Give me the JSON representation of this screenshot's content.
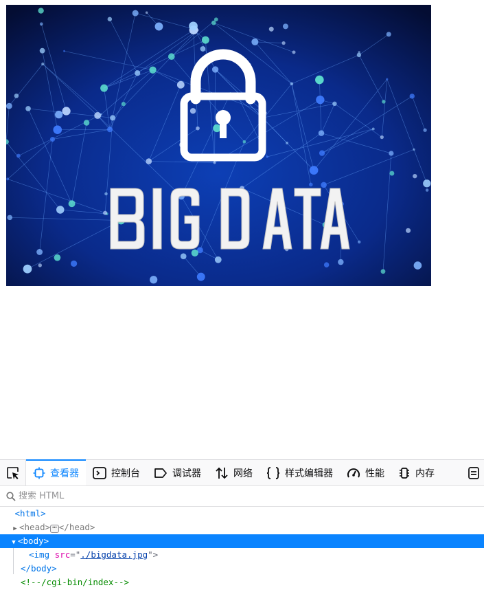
{
  "page": {
    "image": {
      "alt_text": "BIG DATA"
    }
  },
  "devtools": {
    "tabs": [
      {
        "label": "查看器",
        "icon": "inspector-icon",
        "selected": true
      },
      {
        "label": "控制台",
        "icon": "console-icon",
        "selected": false
      },
      {
        "label": "调试器",
        "icon": "debugger-icon",
        "selected": false
      },
      {
        "label": "网络",
        "icon": "network-icon",
        "selected": false
      },
      {
        "label": "样式编辑器",
        "icon": "style-editor-icon",
        "selected": false
      },
      {
        "label": "性能",
        "icon": "performance-icon",
        "selected": false
      },
      {
        "label": "内存",
        "icon": "memory-icon",
        "selected": false
      }
    ],
    "search": {
      "placeholder": "搜索 HTML",
      "value": ""
    },
    "tree": {
      "html_open": "<html>",
      "head_open": "<head>",
      "head_close": "</head>",
      "body_open": "<body>",
      "img_tag_start": "<img",
      "img_attr_name": "src",
      "img_attr_eq": "=\"",
      "img_attr_value": "./bigdata.jpg",
      "img_tag_end": "\">",
      "body_close": "</body>",
      "comment": "<!--/cgi-bin/index-->"
    },
    "colors": {
      "accent": "#0a84ff",
      "tag": "#0074e8",
      "attr": "#dd00a9",
      "comment": "#058b00"
    }
  }
}
